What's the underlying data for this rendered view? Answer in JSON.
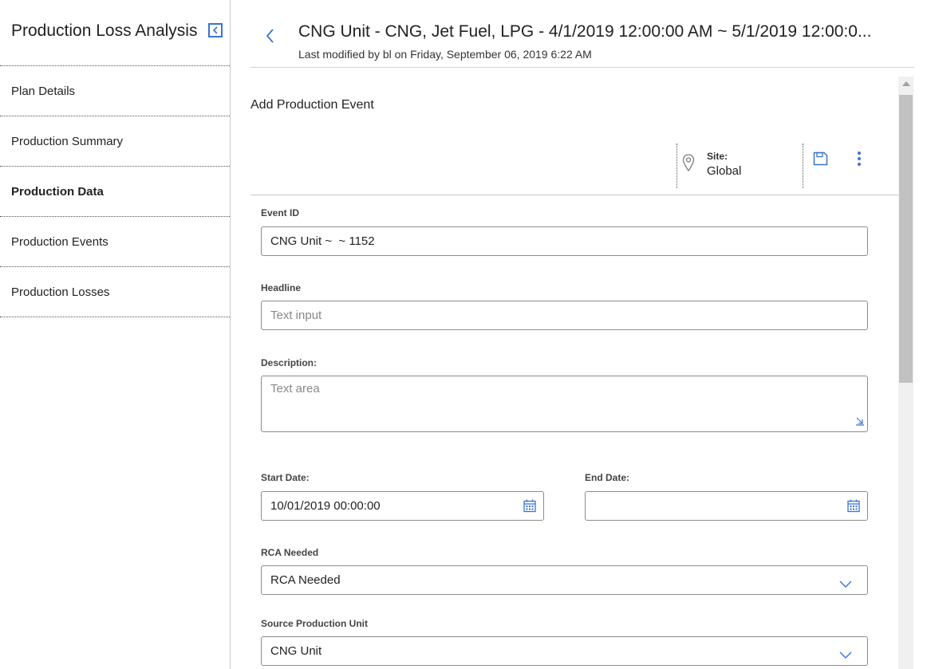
{
  "sidebar": {
    "title": "Production Loss Analysis",
    "items": [
      {
        "label": "Plan Details",
        "active": false
      },
      {
        "label": "Production Summary",
        "active": false
      },
      {
        "label": "Production Data",
        "active": true
      },
      {
        "label": "Production Events",
        "active": false
      },
      {
        "label": "Production Losses",
        "active": false
      }
    ]
  },
  "header": {
    "title": "CNG Unit - CNG, Jet Fuel, LPG - 4/1/2019 12:00:00 AM ~ 5/1/2019 12:00:0...",
    "subtitle": "Last modified by bl on Friday, September 06, 2019 6:22 AM"
  },
  "section": {
    "title": "Add Production Event"
  },
  "toolbar": {
    "site_label": "Site:",
    "site_value": "Global"
  },
  "form": {
    "event_id": {
      "label": "Event ID",
      "value": "CNG Unit ~  ~ 1152"
    },
    "headline": {
      "label": "Headline",
      "placeholder": "Text input"
    },
    "description": {
      "label": "Description:",
      "placeholder": "Text area"
    },
    "start_date": {
      "label": "Start Date:",
      "value": "10/01/2019 00:00:00"
    },
    "end_date": {
      "label": "End Date:",
      "value": ""
    },
    "rca_needed": {
      "label": "RCA Needed",
      "value": "RCA Needed"
    },
    "source_unit": {
      "label": "Source Production Unit",
      "value": "CNG Unit"
    }
  },
  "colors": {
    "accent": "#3b73d1",
    "border": "#8c8c8c"
  }
}
